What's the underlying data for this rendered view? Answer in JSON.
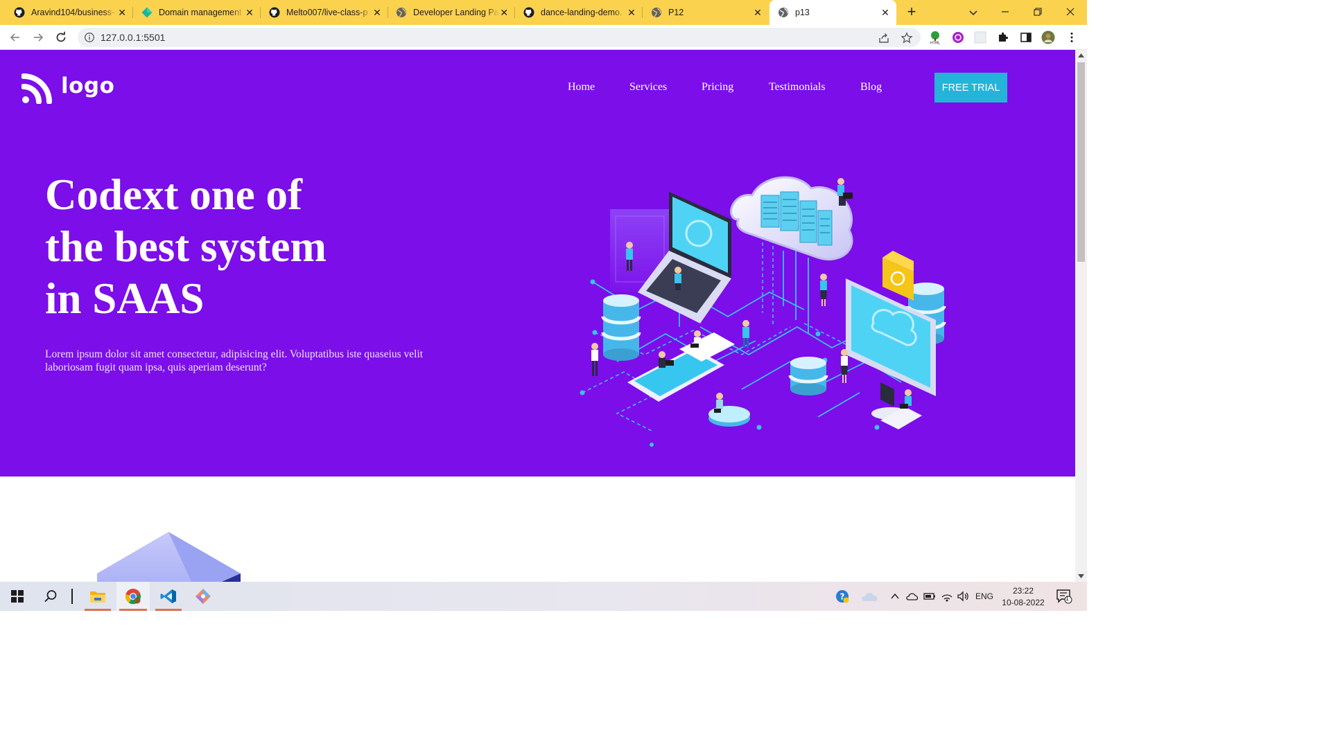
{
  "browser": {
    "tabs": [
      {
        "title": "Aravind104/business-",
        "icon": "github-icon",
        "active": false
      },
      {
        "title": "Domain management",
        "icon": "diamond-icon",
        "active": false
      },
      {
        "title": "Melto007/live-class-p",
        "icon": "github-icon",
        "active": false
      },
      {
        "title": "Developer Landing Pa",
        "icon": "globe-icon",
        "active": false
      },
      {
        "title": "dance-landing-demo.",
        "icon": "github-icon",
        "active": false
      },
      {
        "title": "P12",
        "icon": "globe-icon",
        "active": false
      },
      {
        "title": "p13",
        "icon": "globe-icon",
        "active": true
      }
    ],
    "new_tab_label": "+",
    "url": "127.0.0.1:5501"
  },
  "page": {
    "logo_text": "logo",
    "nav": [
      "Home",
      "Services",
      "Pricing",
      "Testimonials",
      "Blog"
    ],
    "cta_label": "FREE TRIAL",
    "headline": [
      "Codext one of",
      "the best system",
      "in SAAS"
    ],
    "subtext": "Lorem ipsum dolor sit amet consectetur, adipisicing elit. Voluptatibus iste quaseius velit laboriosam fugit quam ipsa, quis aperiam deserunt?",
    "colors": {
      "hero_bg": "#7b0ee9",
      "cta_bg": "#25b4d9",
      "text": "#ffffff"
    }
  },
  "taskbar": {
    "apps": [
      "windows-start-icon",
      "search-icon",
      "task-view-icon",
      "file-explorer-icon",
      "chrome-icon",
      "vscode-icon",
      "git-icon"
    ],
    "language": "ENG",
    "time": "23:22",
    "date": "10-08-2022",
    "notification_count": "1"
  }
}
